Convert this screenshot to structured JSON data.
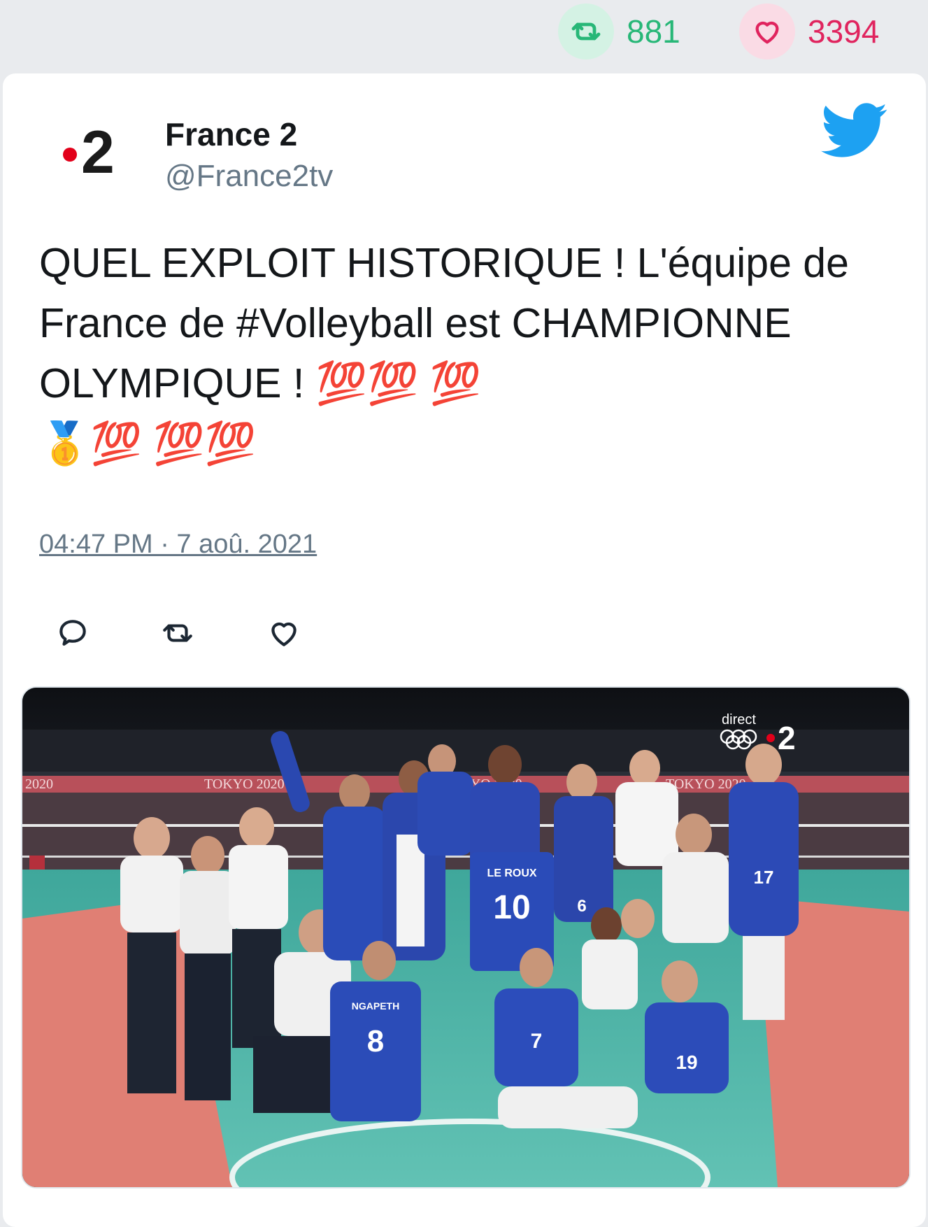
{
  "stats": {
    "retweets": "881",
    "likes": "3394"
  },
  "tweet": {
    "author_name": "France 2",
    "author_handle": "@France2tv",
    "avatar_text": "2",
    "text": "QUEL EXPLOIT HISTORIQUE ! L'équipe de France de #Volleyball est CHAMPIONNE OLYMPIQUE ! 💯💯 💯\n🥇💯 💯💯",
    "timestamp": "04:47 PM · 7 aoû. 2021"
  },
  "media": {
    "broadcast_label": "direct",
    "channel_number": "2",
    "banner_texts": [
      "TOKYO 2020",
      "TOKYO 2020",
      "TOKYO 2020",
      "2020"
    ],
    "jersey_labels": [
      "LE ROUX",
      "10",
      "NGAPETH",
      "8",
      "7",
      "19",
      "17",
      "6"
    ]
  },
  "icons": {
    "retweet": "retweet-icon",
    "like": "heart-icon",
    "reply": "reply-icon",
    "brand": "twitter-bird-icon"
  },
  "colors": {
    "retweet": "#27b777",
    "like": "#e0245e",
    "twitter_blue": "#1da1f2",
    "france2_red": "#e2001a"
  }
}
